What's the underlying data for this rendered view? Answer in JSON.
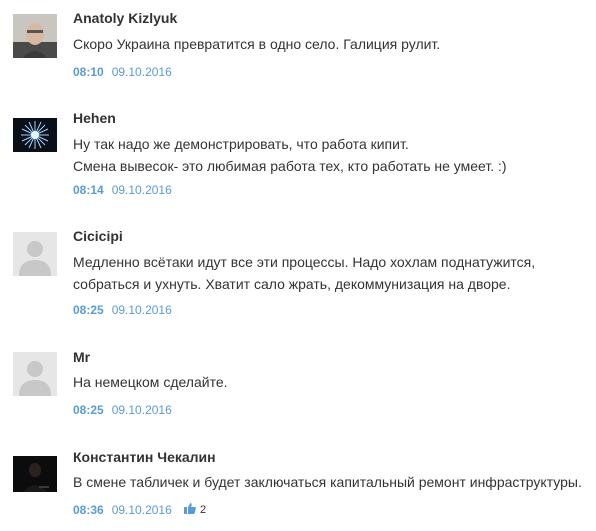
{
  "comments": [
    {
      "author": "Anatoly Kizlyuk",
      "avatar": "photo-avatar",
      "lines": [
        "Скоро Украина превратится в одно село. Галиция рулит."
      ],
      "time": "08:10",
      "date": "09.10.2016"
    },
    {
      "author": "Hehen",
      "avatar": "starburst-avatar",
      "lines": [
        "Ну так надо же демонстрировать, что работа кипит.",
        "Смена вывесок- это любимая работа тех, кто работать не умеет. :)"
      ],
      "time": "08:14",
      "date": "09.10.2016"
    },
    {
      "author": "Cicicipi",
      "avatar": "default-user-avatar",
      "lines": [
        "Медленно всётаки идут все эти процессы. Надо хохлам поднатужится,",
        "собраться и ухнуть. Хватит сало жрать, декоммунизация на дворе."
      ],
      "time": "08:25",
      "date": "09.10.2016"
    },
    {
      "author": "Mr",
      "avatar": "default-user-avatar",
      "lines": [
        "На немецком сделайте."
      ],
      "time": "08:25",
      "date": "09.10.2016"
    },
    {
      "author": "Константин Чекалин",
      "avatar": "dark-photo-avatar",
      "lines": [
        "В смене табличек и будет заключаться капитальный ремонт инфраструктуры."
      ],
      "time": "08:36",
      "date": "09.10.2016",
      "likes": "2",
      "like_icon": "thumbs-up-icon"
    }
  ],
  "colors": {
    "link": "#5b9bd5",
    "text": "#333333",
    "avatar_placeholder": "#e6e6e6"
  }
}
